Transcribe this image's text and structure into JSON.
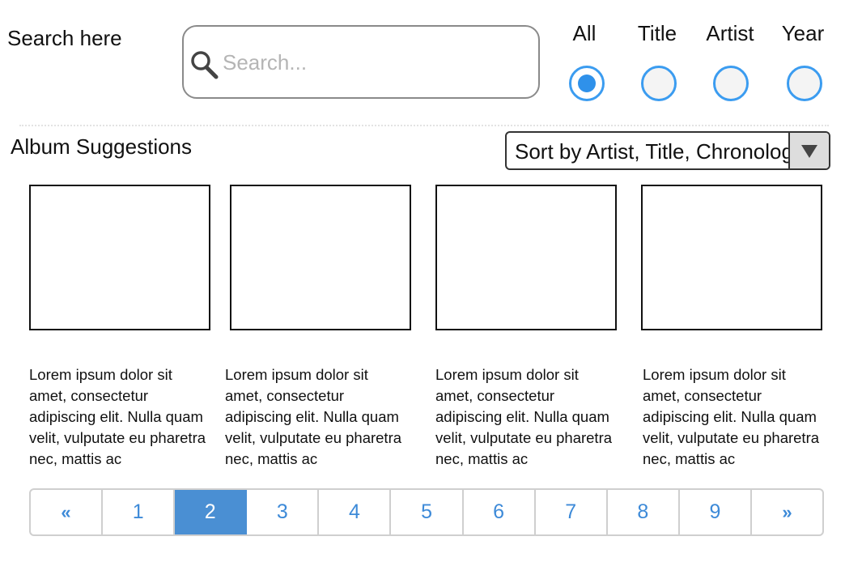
{
  "search": {
    "label": "Search here",
    "placeholder": "Search...",
    "value": ""
  },
  "filter": {
    "options": [
      {
        "label": "All",
        "checked": true
      },
      {
        "label": "Title",
        "checked": false
      },
      {
        "label": "Artist",
        "checked": false
      },
      {
        "label": "Year",
        "checked": false
      }
    ]
  },
  "suggestions": {
    "title": "Album Suggestions",
    "sort_value": "Sort by Artist, Title, Chronological"
  },
  "albums": [
    {
      "description": "Lorem ipsum dolor sit amet, consectetur adipiscing elit. Nulla quam velit, vulputate eu pharetra nec, mattis ac"
    },
    {
      "description": "Lorem ipsum dolor sit amet, consectetur adipiscing elit. Nulla quam velit, vulputate eu pharetra nec, mattis ac"
    },
    {
      "description": "Lorem ipsum dolor sit amet, consectetur adipiscing elit. Nulla quam velit, vulputate eu pharetra nec, mattis ac"
    },
    {
      "description": "Lorem ipsum dolor sit amet, consectetur adipiscing elit. Nulla quam velit, vulputate eu pharetra nec, mattis ac"
    }
  ],
  "pagination": {
    "prev": "«",
    "next": "»",
    "pages": [
      "1",
      "2",
      "3",
      "4",
      "5",
      "6",
      "7",
      "8",
      "9"
    ],
    "current": "2"
  },
  "colors": {
    "accent": "#3b9cf0",
    "active_page": "#4a8fd3",
    "link": "#3d8ad8"
  }
}
